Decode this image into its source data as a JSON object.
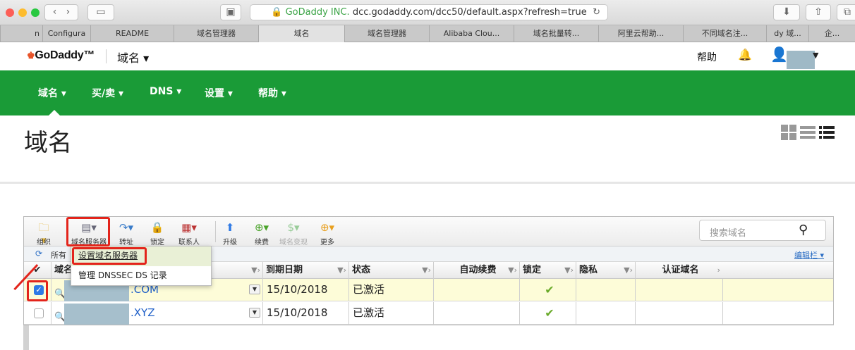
{
  "browser": {
    "secure_label": "GoDaddy INC.",
    "url": "dcc.godaddy.com/dcc50/default.aspx?refresh=true",
    "tabs": [
      "n",
      "Configura",
      "README",
      "域名管理器",
      "域名",
      "域名管理器",
      "Alibaba Clou...",
      "域名批量转...",
      "阿里云帮助...",
      "不同域名注...",
      "dy 域...",
      "企..."
    ]
  },
  "header": {
    "logo": "GoDaddy",
    "product": "域名 ▾",
    "help": "帮助"
  },
  "nav": {
    "items": [
      "域名 ▾",
      "买/卖 ▾",
      "DNS ▾",
      "设置 ▾",
      "帮助 ▾"
    ]
  },
  "page": {
    "title": "域名"
  },
  "toolbar": {
    "buttons": [
      "组织",
      "域名服务器",
      "转址",
      "锁定",
      "联系人",
      "升级",
      "续费",
      "域名变现",
      "更多"
    ],
    "search_placeholder": "搜索域名"
  },
  "subbar": {
    "all_text": "所有",
    "edit_columns": "编辑栏 ▾"
  },
  "menu": {
    "items": [
      "设置域名服务器",
      "管理 DNSSEC DS 记录"
    ]
  },
  "table": {
    "headers": [
      "域名",
      "到期日期",
      "状态",
      "自动续费",
      "锁定",
      "隐私",
      "认证域名"
    ],
    "rows": [
      {
        "domain_suffix": ".COM",
        "expires": "15/10/2018",
        "status": "已激活",
        "selected": true
      },
      {
        "domain_suffix": ".XYZ",
        "expires": "15/10/2018",
        "status": "已激活",
        "selected": false
      }
    ]
  },
  "colors": {
    "brand_green": "#1a9b37",
    "highlight": "#e3241b",
    "link_blue": "#2060c8"
  }
}
